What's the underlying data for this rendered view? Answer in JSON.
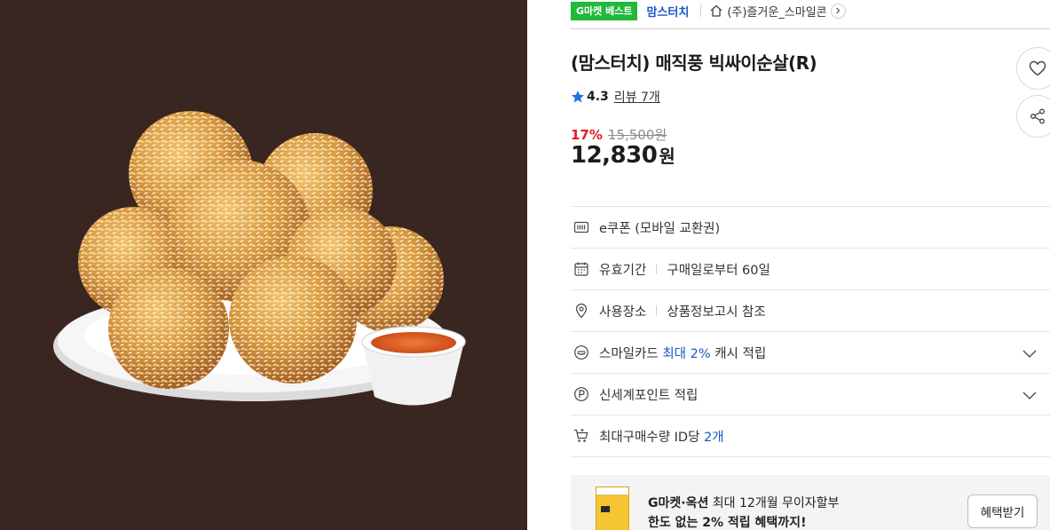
{
  "breadcrumb": {
    "badge": "G마켓 베스트",
    "brand": "맘스터치",
    "shop": "(주)즐거운_스마일콘"
  },
  "product": {
    "title": "(맘스터치) 매직풍 빅싸이순살(R)",
    "rating": "4.3",
    "review_link": "리뷰 7개",
    "discount_rate": "17%",
    "original_price": "15,500원",
    "sale_price": "12,830",
    "currency": "원"
  },
  "info_rows": {
    "coupon": "e쿠폰 (모바일 교환권)",
    "validity_label": "유효기간",
    "validity_value": "구매일로부터 60일",
    "place_label": "사용장소",
    "place_value": "상품정보고시 참조",
    "smilecard_prefix": "스마일카드 ",
    "smilecard_highlight": "최대 2%",
    "smilecard_suffix": " 캐시 적립",
    "points": "신세계포인트 적립",
    "maxqty_prefix": "최대구매수량 ID당 ",
    "maxqty_highlight": "2개"
  },
  "promo": {
    "line1_bold": "G마켓·옥션",
    "line1_rest": " 최대 12개월 무이자할부",
    "line2": "한도 없는 2% 적립 혜택까지!",
    "button": "혜택받기"
  },
  "icons": {
    "home": "home-icon",
    "wish": "heart-icon",
    "share": "share-icon",
    "star": "star-icon",
    "coupon": "barcode-icon",
    "validity": "calendar-icon",
    "place": "location-pin-icon",
    "smilecard": "smile-card-icon",
    "points": "point-p-icon",
    "qty": "cart-icon"
  },
  "colors": {
    "image_bg": "#3a2620",
    "badge_green": "#21b93a",
    "link_blue": "#1a56c8",
    "discount_red": "#e41b23"
  }
}
